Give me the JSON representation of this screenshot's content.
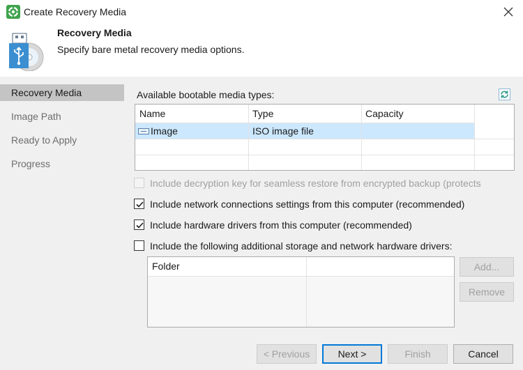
{
  "window": {
    "title": "Create Recovery Media"
  },
  "header": {
    "title": "Recovery Media",
    "subtitle": "Specify bare metal recovery media options."
  },
  "nav": {
    "items": [
      {
        "label": "Recovery Media",
        "active": true
      },
      {
        "label": "Image Path",
        "active": false
      },
      {
        "label": "Ready to Apply",
        "active": false
      },
      {
        "label": "Progress",
        "active": false
      }
    ]
  },
  "media": {
    "label": "Available bootable media types:",
    "columns": [
      "Name",
      "Type",
      "Capacity"
    ],
    "rows": [
      {
        "name": "Image",
        "type": "ISO image file",
        "capacity": ""
      }
    ]
  },
  "options": [
    {
      "label": "Include decryption key for seamless restore from encrypted backup (protects",
      "checked": false,
      "disabled": true
    },
    {
      "label": "Include network connections settings from this computer (recommended)",
      "checked": true,
      "disabled": false
    },
    {
      "label": "Include hardware drivers from this computer (recommended)",
      "checked": true,
      "disabled": false
    },
    {
      "label": "Include the following additional storage and network hardware drivers:",
      "checked": false,
      "disabled": false
    }
  ],
  "drivers": {
    "columns": [
      "Folder",
      ""
    ],
    "add_label": "Add...",
    "remove_label": "Remove"
  },
  "footer": {
    "previous_label": "< Previous",
    "next_label": "Next >",
    "finish_label": "Finish",
    "cancel_label": "Cancel"
  },
  "colors": {
    "selection": "#cce8ff",
    "accent": "#0078d7",
    "icon_green": "#3fa34d",
    "icon_blue": "#3b8fd1"
  }
}
